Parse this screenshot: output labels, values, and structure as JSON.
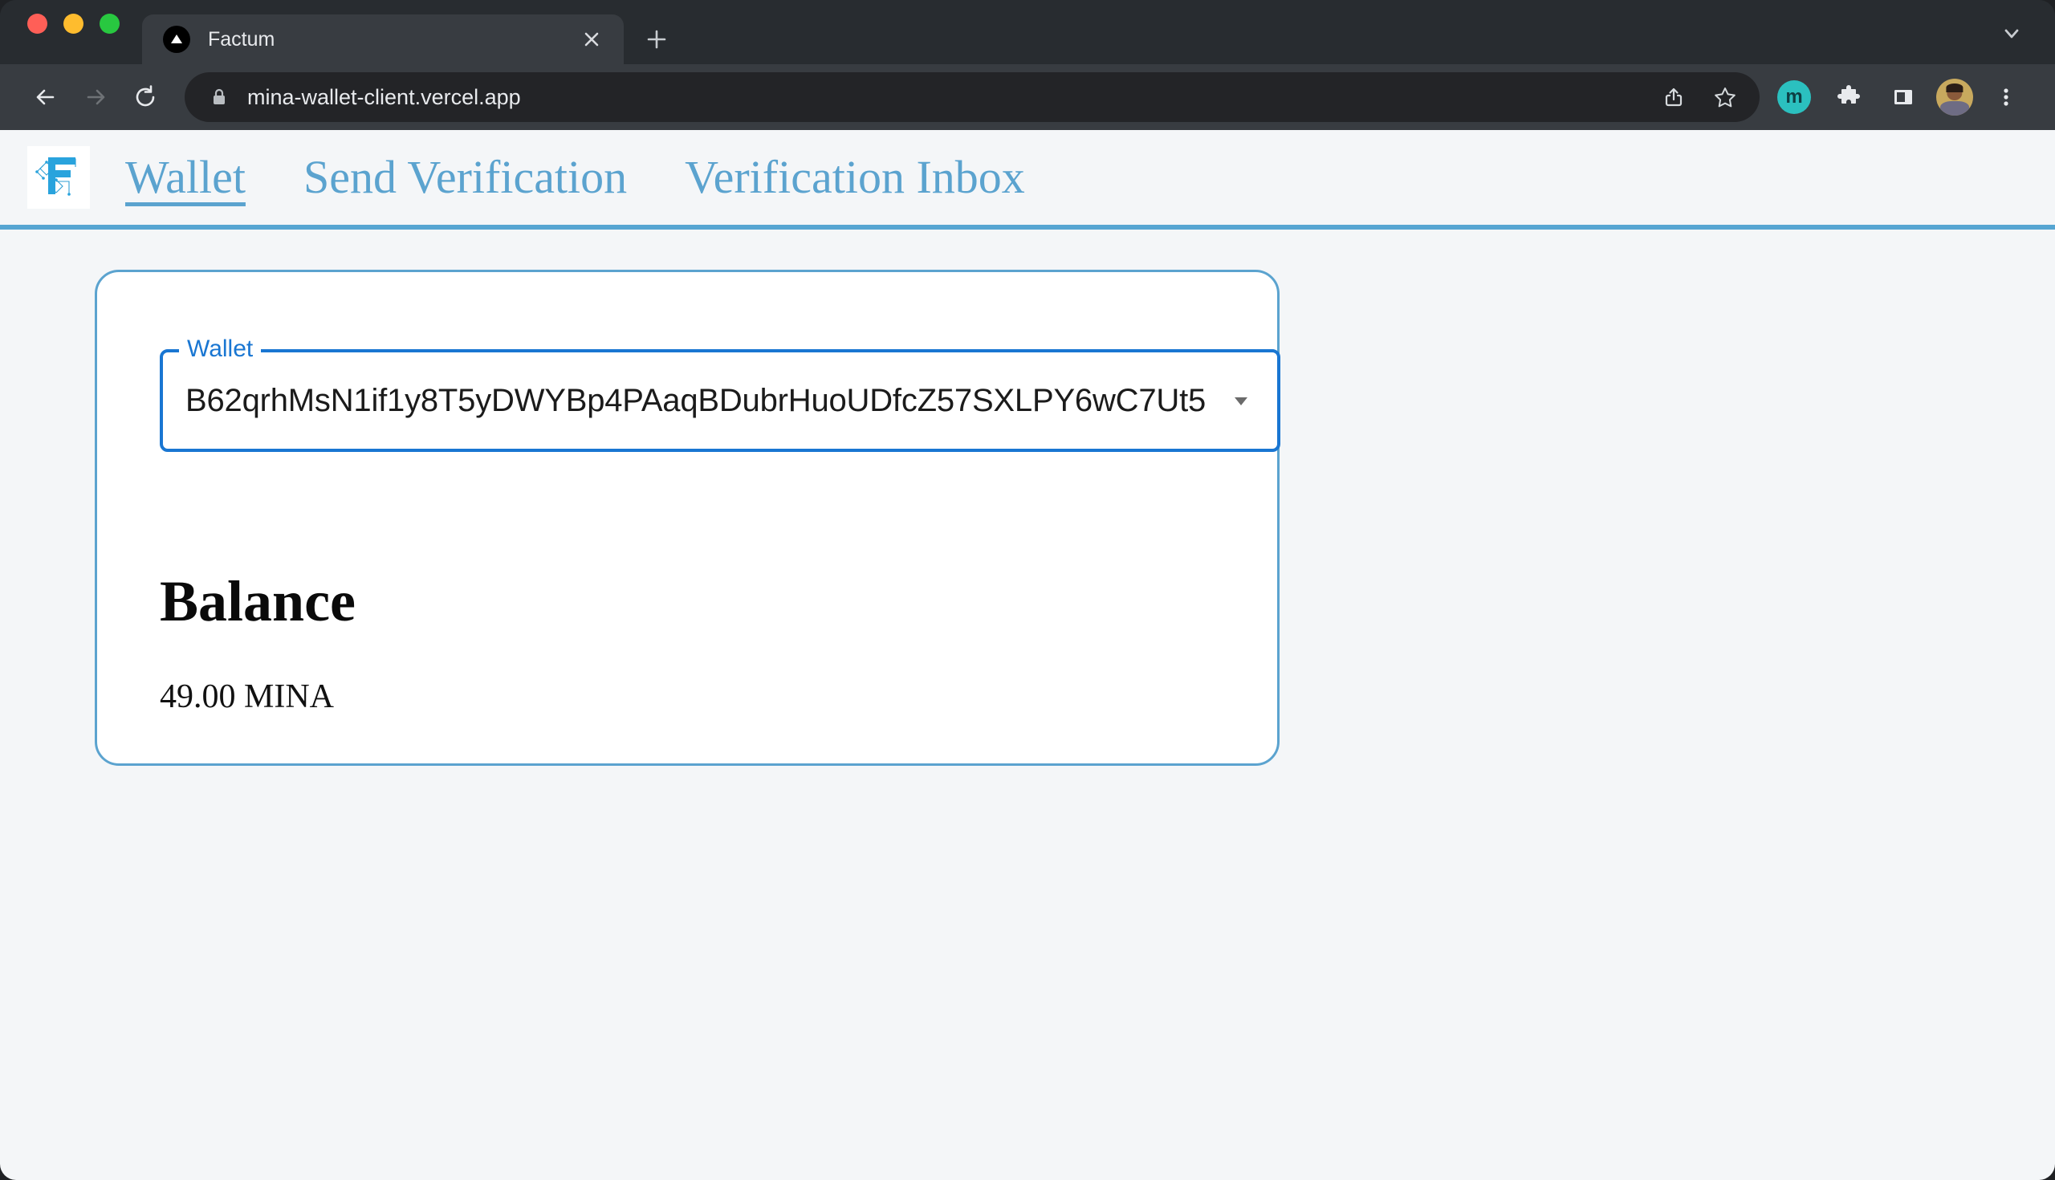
{
  "browser": {
    "traffic_lights": [
      "close",
      "minimize",
      "zoom"
    ],
    "tab": {
      "title": "Factum",
      "favicon": "triangle-favicon",
      "close_label": "×"
    },
    "new_tab_label": "+",
    "tabstrip_chevron": "chevron-down-icon",
    "toolbar": {
      "back": "back-arrow-icon",
      "forward": "forward-arrow-icon",
      "reload": "reload-icon",
      "lock": "lock-icon",
      "url": "mina-wallet-client.vercel.app",
      "share": "share-icon",
      "bookmark": "star-icon",
      "extension_mina_label": "m",
      "extensions": "puzzle-icon",
      "side_panel": "side-panel-icon",
      "profile": "avatar",
      "menu": "three-dot-menu-icon"
    }
  },
  "app": {
    "logo_alt": "factum-logo",
    "nav": [
      {
        "label": "Wallet",
        "active": true
      },
      {
        "label": "Send Verification",
        "active": false
      },
      {
        "label": "Verification Inbox",
        "active": false
      }
    ],
    "wallet_field": {
      "label": "Wallet",
      "value": "B62qrhMsN1if1y8T5yDWYBp4PAaqBDubrHuoUDfcZ57SXLPY6wC7Ut5",
      "caret": "dropdown-caret-icon"
    },
    "balance": {
      "heading": "Balance",
      "amount": "49.00 MINA"
    }
  },
  "colors": {
    "accent_blue": "#5ba3cf",
    "focus_blue": "#1976d2",
    "page_bg": "#f4f6f8",
    "card_bg": "#ffffff",
    "chrome_bg": "#383c41",
    "tabstrip_bg": "#282c30"
  }
}
